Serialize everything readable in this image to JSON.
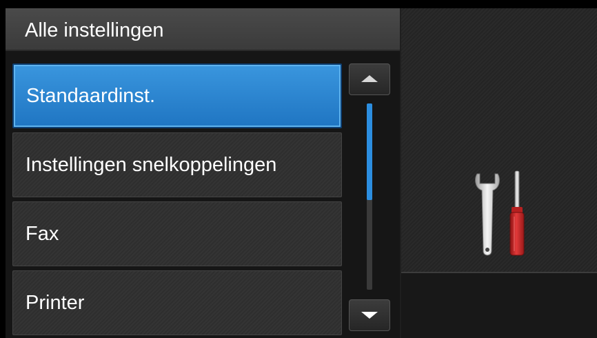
{
  "header": {
    "title": "Alle instellingen"
  },
  "menu": {
    "items": [
      {
        "label": "Standaardinst.",
        "selected": true
      },
      {
        "label": "Instellingen snelkoppelingen",
        "selected": false
      },
      {
        "label": "Fax",
        "selected": false
      },
      {
        "label": "Printer",
        "selected": false
      }
    ]
  },
  "scrollbar": {
    "position_fraction": 0.0,
    "visible_fraction": 0.52
  },
  "icons": {
    "scroll_up": "triangle-up-icon",
    "scroll_down": "triangle-down-icon",
    "settings": "wrench-screwdriver-icon"
  },
  "colors": {
    "selected": "#2a86d3",
    "scroll_thumb": "#2c8ee0",
    "screwdriver_handle": "#d42a2a"
  }
}
